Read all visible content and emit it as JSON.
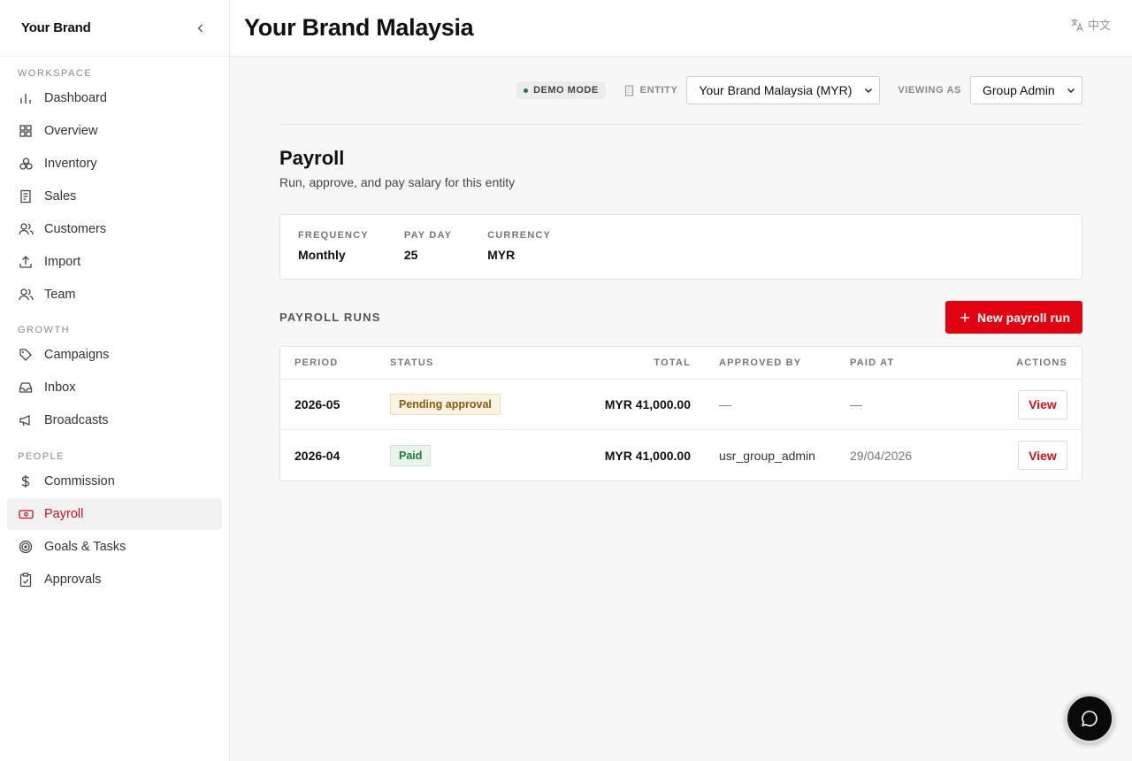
{
  "sidebar": {
    "brand": "Your Brand",
    "sections": [
      {
        "label": "WORKSPACE",
        "items": [
          {
            "label": "Dashboard",
            "icon": "bar-chart-icon"
          },
          {
            "label": "Overview",
            "icon": "grid-icon"
          },
          {
            "label": "Inventory",
            "icon": "boxes-icon"
          },
          {
            "label": "Sales",
            "icon": "receipt-icon"
          },
          {
            "label": "Customers",
            "icon": "users-icon"
          },
          {
            "label": "Import",
            "icon": "upload-icon"
          },
          {
            "label": "Team",
            "icon": "team-icon"
          }
        ]
      },
      {
        "label": "GROWTH",
        "items": [
          {
            "label": "Campaigns",
            "icon": "tag-icon"
          },
          {
            "label": "Inbox",
            "icon": "inbox-icon"
          },
          {
            "label": "Broadcasts",
            "icon": "megaphone-icon"
          }
        ]
      },
      {
        "label": "PEOPLE",
        "items": [
          {
            "label": "Commission",
            "icon": "dollar-icon"
          },
          {
            "label": "Payroll",
            "icon": "banknote-icon",
            "active": true
          },
          {
            "label": "Goals & Tasks",
            "icon": "target-icon"
          },
          {
            "label": "Approvals",
            "icon": "clipboard-check-icon"
          }
        ]
      }
    ]
  },
  "header": {
    "title": "Your Brand Malaysia",
    "language": "中文"
  },
  "toolbar": {
    "demo_mode": "DEMO MODE",
    "entity_label": "ENTITY",
    "entity_value": "Your Brand Malaysia (MYR)",
    "viewing_as_label": "VIEWING AS",
    "viewing_as_value": "Group Admin"
  },
  "payroll": {
    "title": "Payroll",
    "subtitle": "Run, approve, and pay salary for this entity",
    "info": [
      {
        "key": "FREQUENCY",
        "value": "Monthly"
      },
      {
        "key": "PAY DAY",
        "value": "25"
      },
      {
        "key": "CURRENCY",
        "value": "MYR"
      }
    ]
  },
  "runs": {
    "title": "PAYROLL RUNS",
    "new_button": "New payroll run",
    "columns": [
      "PERIOD",
      "STATUS",
      "TOTAL",
      "APPROVED BY",
      "PAID AT",
      "ACTIONS"
    ],
    "rows": [
      {
        "period": "2026-05",
        "status": "Pending approval",
        "status_type": "pending",
        "total": "MYR 41,000.00",
        "approved_by": "—",
        "paid_at": "—",
        "action": "View"
      },
      {
        "period": "2026-04",
        "status": "Paid",
        "status_type": "paid",
        "total": "MYR 41,000.00",
        "approved_by": "usr_group_admin",
        "paid_at": "29/04/2026",
        "action": "View"
      }
    ]
  },
  "colors": {
    "accent": "#e0000f",
    "active_nav": "#d3101c",
    "paid_green": "#1e7a3a",
    "pending_brown": "#8a5a0c"
  }
}
